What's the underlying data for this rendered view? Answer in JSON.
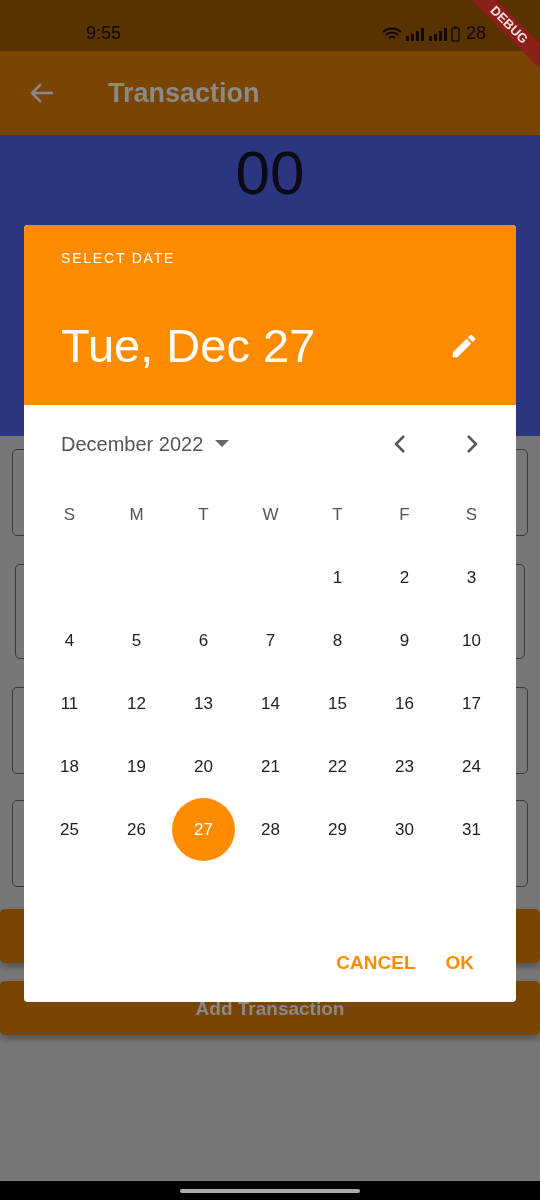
{
  "status_bar": {
    "time": "9:55",
    "battery": "28"
  },
  "debug_banner": "DEBUG",
  "app_bar": {
    "title": "Transaction"
  },
  "amount": "00",
  "submit_button": "Add Transaction",
  "date_picker": {
    "label": "SELECT DATE",
    "selected_date": "Tue, Dec 27",
    "month": "December 2022",
    "weekdays": [
      "S",
      "M",
      "T",
      "W",
      "T",
      "F",
      "S"
    ],
    "weeks": [
      [
        {
          "kind": "blank"
        },
        {
          "kind": "blank"
        },
        {
          "kind": "blank"
        },
        {
          "kind": "blank"
        },
        {
          "kind": "day",
          "day": "1",
          "selected": false
        },
        {
          "day": "2",
          "selected": false
        },
        {
          "day": "3",
          "selected": false
        }
      ],
      [
        {
          "day": "4",
          "selected": false
        },
        {
          "day": "5",
          "selected": false
        },
        {
          "day": "6",
          "selected": false
        },
        {
          "day": "7",
          "selected": false
        },
        {
          "day": "8",
          "selected": false
        },
        {
          "day": "9",
          "selected": false
        },
        {
          "day": "10",
          "selected": false
        }
      ],
      [
        {
          "day": "11",
          "selected": false
        },
        {
          "day": "12",
          "selected": false
        },
        {
          "day": "13",
          "selected": false
        },
        {
          "day": "14",
          "selected": false
        },
        {
          "day": "15",
          "selected": false
        },
        {
          "day": "16",
          "selected": false
        },
        {
          "day": "17",
          "selected": false
        }
      ],
      [
        {
          "day": "18",
          "selected": false
        },
        {
          "day": "19",
          "selected": false
        },
        {
          "day": "20",
          "selected": false
        },
        {
          "day": "21",
          "selected": false
        },
        {
          "day": "22",
          "selected": false
        },
        {
          "day": "23",
          "selected": false
        },
        {
          "day": "24",
          "selected": false
        }
      ],
      [
        {
          "day": "25",
          "selected": false
        },
        {
          "day": "26",
          "selected": false
        },
        {
          "day": "27",
          "selected": true
        },
        {
          "day": "28",
          "selected": false
        },
        {
          "day": "29",
          "selected": false
        },
        {
          "day": "30",
          "selected": false
        },
        {
          "day": "31",
          "selected": false
        }
      ]
    ],
    "actions": [
      "CANCEL",
      "OK"
    ]
  }
}
